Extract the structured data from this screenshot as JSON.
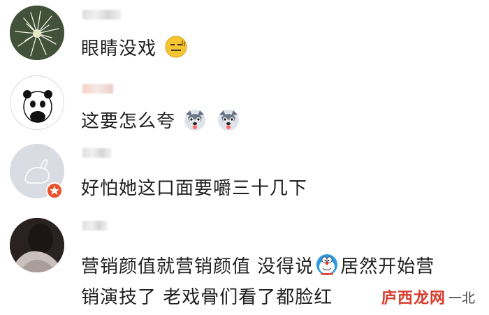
{
  "comments": [
    {
      "text_line1": "眼睛没戏",
      "text_line2": "",
      "emojis": [
        "squint-face-emoji"
      ]
    },
    {
      "text_line1": "这要怎么夸",
      "text_line2": "",
      "emojis": [
        "husky-emoji",
        "husky-emoji"
      ]
    },
    {
      "text_line1": "好怕她这口面要嚼三十几下",
      "text_line2": "",
      "emojis": []
    },
    {
      "text_line1_a": "营销颜值就营销颜值 没得说",
      "text_line1_b": "居然开始营",
      "text_line2": "销演技了 老戏骨们看了都脸红",
      "emojis": [
        "doraemon-emoji"
      ]
    }
  ],
  "watermark": {
    "brand": "庐西龙网",
    "author": "一北"
  },
  "colors": {
    "background": "#ffffff",
    "text": "#1f1f1f",
    "badge": "#e8532c",
    "watermark": "#d63a2a"
  }
}
